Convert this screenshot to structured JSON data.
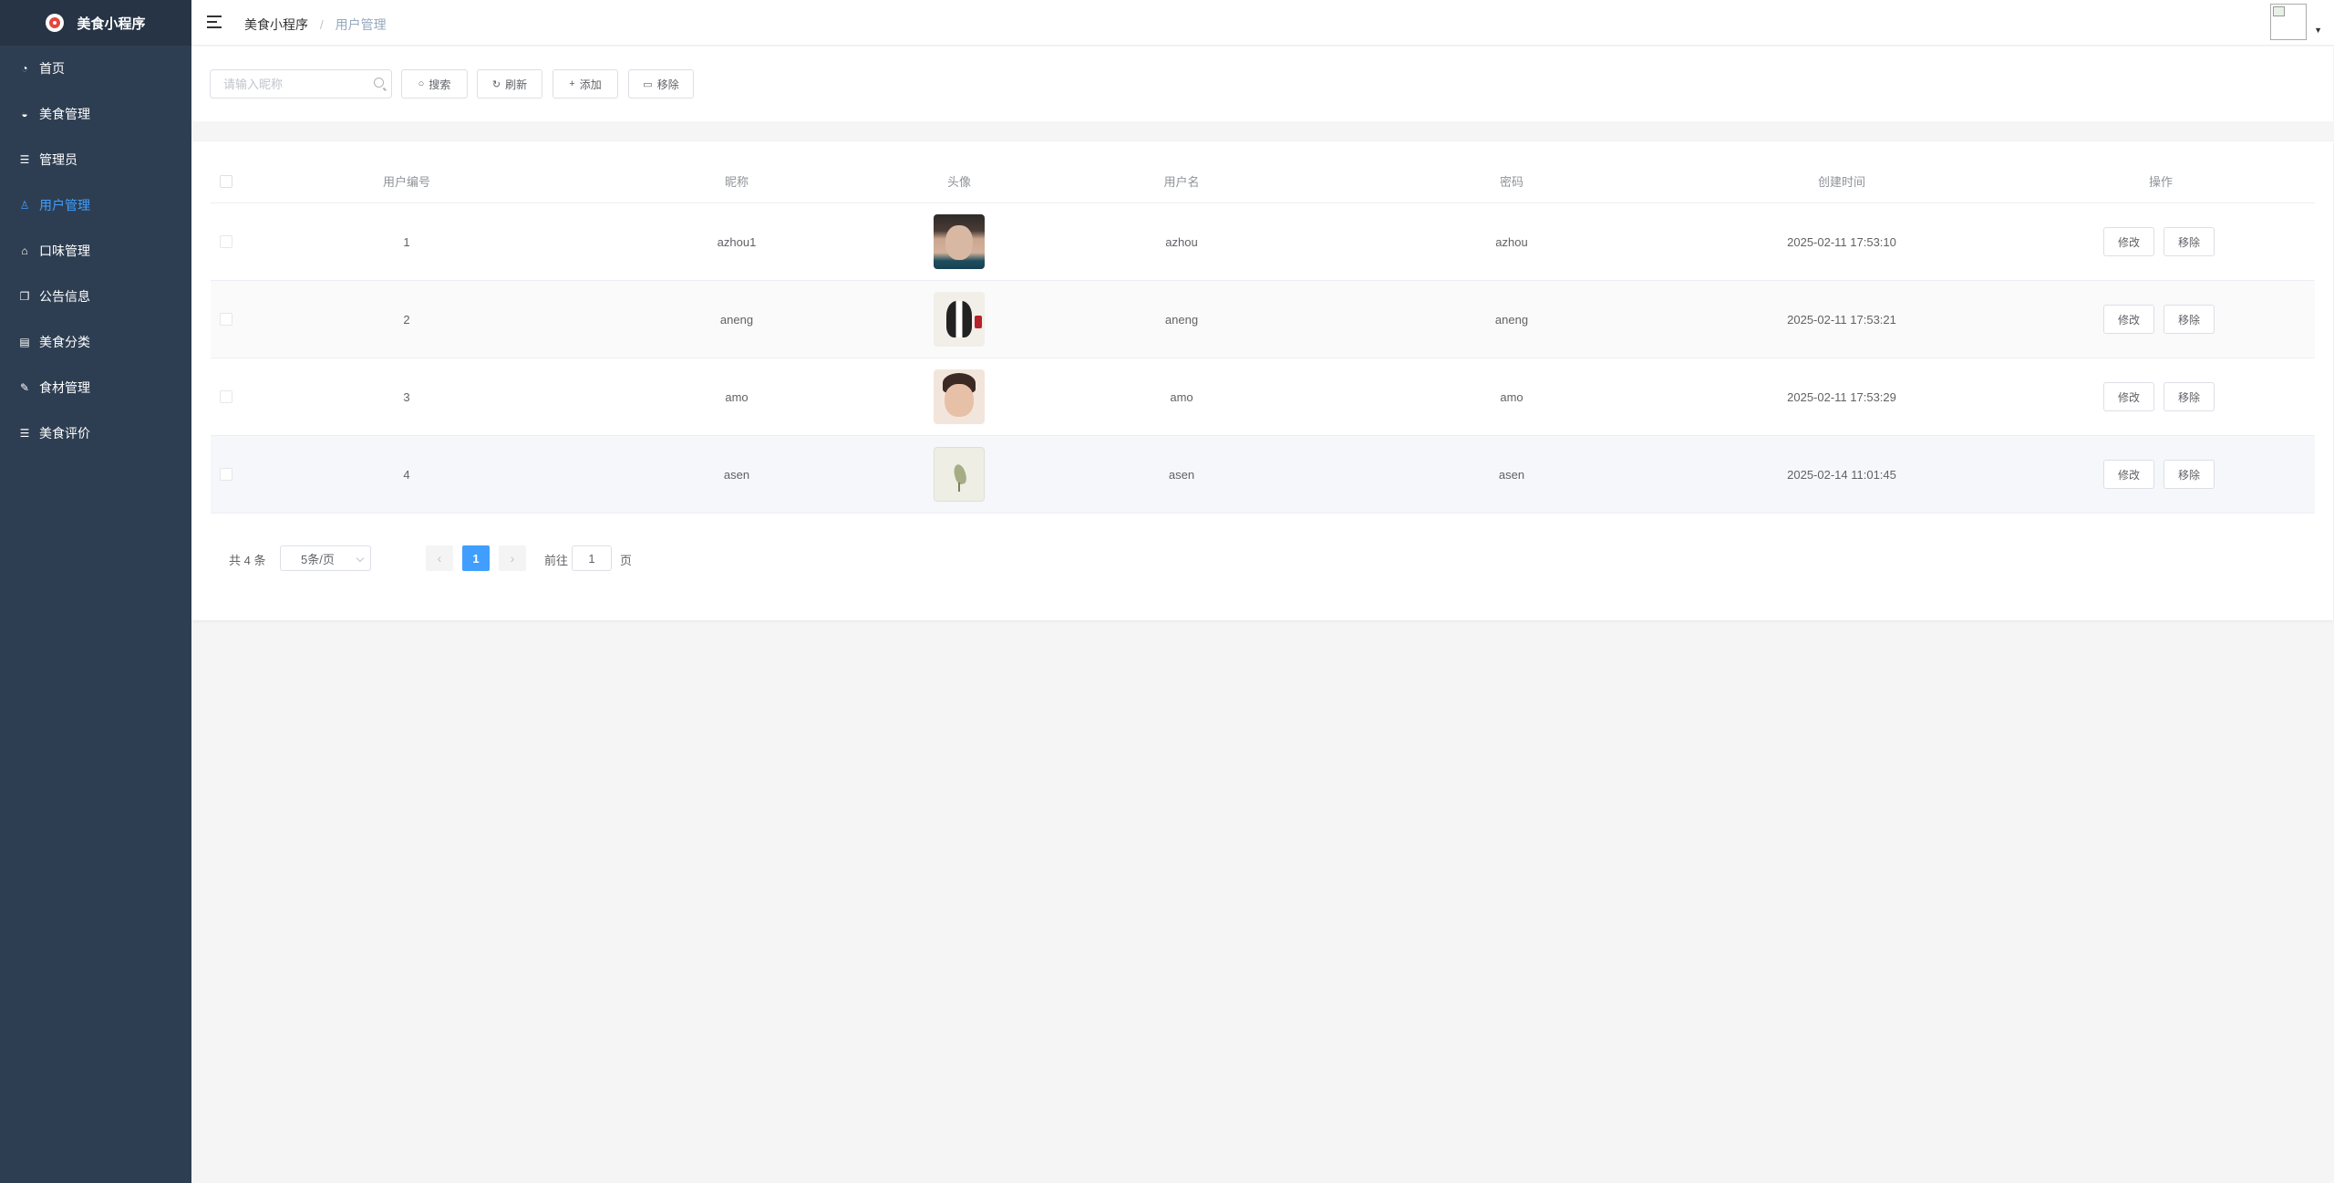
{
  "app": {
    "title": "美食小程序"
  },
  "sidebar": {
    "items": [
      {
        "label": "首页",
        "icon": "dashboard-icon",
        "glyph": "◔",
        "active": false
      },
      {
        "label": "美食管理",
        "icon": "bowl-icon",
        "glyph": "◒",
        "active": false
      },
      {
        "label": "管理员",
        "icon": "sliders-icon",
        "glyph": "☰",
        "active": false
      },
      {
        "label": "用户管理",
        "icon": "user-icon",
        "glyph": "♙",
        "active": true
      },
      {
        "label": "口味管理",
        "icon": "tray-icon",
        "glyph": "⌂",
        "active": false
      },
      {
        "label": "公告信息",
        "icon": "copy-icon",
        "glyph": "❐",
        "active": false
      },
      {
        "label": "美食分类",
        "icon": "document-icon",
        "glyph": "▤",
        "active": false
      },
      {
        "label": "食材管理",
        "icon": "pen-icon",
        "glyph": "✎",
        "active": false
      },
      {
        "label": "美食评价",
        "icon": "sliders-icon",
        "glyph": "☰",
        "active": false
      }
    ]
  },
  "header": {
    "breadcrumb": {
      "home": "美食小程序",
      "separator": "/",
      "current": "用户管理"
    }
  },
  "toolbar": {
    "search_placeholder": "请输入昵称",
    "search_value": "",
    "buttons": {
      "search": "搜索",
      "refresh": "刷新",
      "add": "添加",
      "remove": "移除"
    }
  },
  "table": {
    "columns": [
      "用户编号",
      "昵称",
      "头像",
      "用户名",
      "密码",
      "创建时间",
      "操作"
    ],
    "rows": [
      {
        "id": "1",
        "nickname": "azhou1",
        "username": "azhou",
        "password": "azhou",
        "created": "2025-02-11 17:53:10"
      },
      {
        "id": "2",
        "nickname": "aneng",
        "username": "aneng",
        "password": "aneng",
        "created": "2025-02-11 17:53:21"
      },
      {
        "id": "3",
        "nickname": "amo",
        "username": "amo",
        "password": "amo",
        "created": "2025-02-11 17:53:29"
      },
      {
        "id": "4",
        "nickname": "asen",
        "username": "asen",
        "password": "asen",
        "created": "2025-02-14 11:01:45"
      }
    ],
    "row_actions": {
      "edit": "修改",
      "remove": "移除"
    }
  },
  "pagination": {
    "total": "共 4 条",
    "page_size": "5条/页",
    "current_page": "1",
    "goto_label": "前往",
    "goto_value": "1",
    "goto_unit": "页"
  },
  "colors": {
    "sidebar_bg": "#2e3e52",
    "accent": "#409eff"
  }
}
